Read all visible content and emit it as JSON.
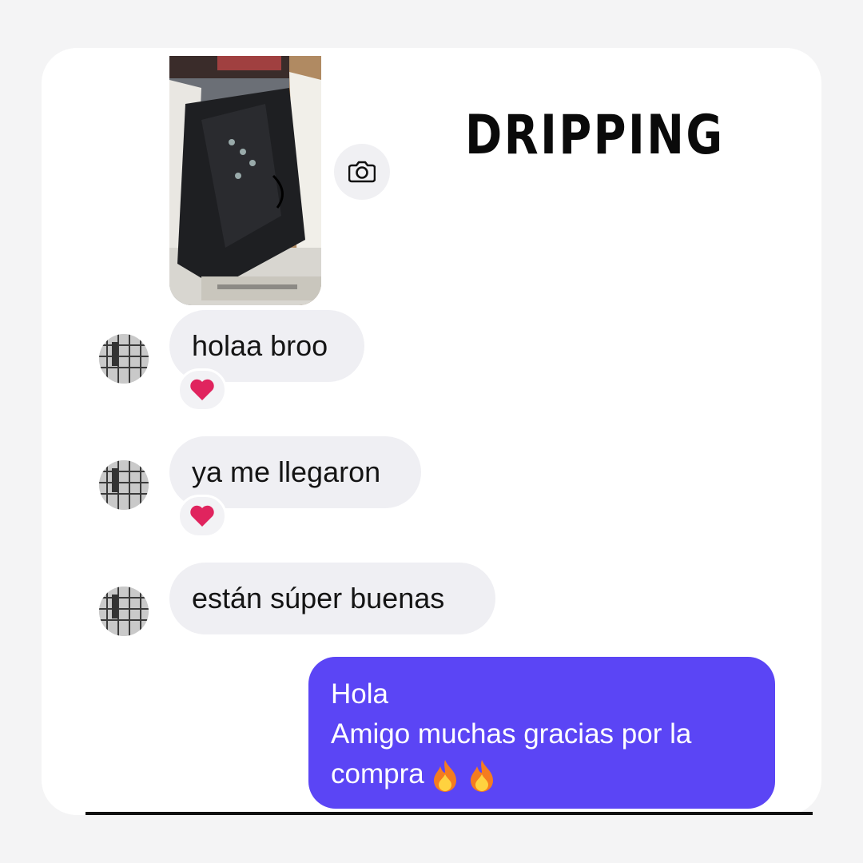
{
  "brand": {
    "title": "DRIPPING"
  },
  "image_message": {
    "alt": "shoe box photo"
  },
  "messages_received": [
    {
      "text": "holaa broo",
      "reaction": "heart"
    },
    {
      "text": "ya me llegaron",
      "reaction": "heart"
    },
    {
      "text": "están súper buenas",
      "reaction": null
    }
  ],
  "message_sent": {
    "line1": "Hola",
    "line2": "Amigo muchas gracias por la",
    "line3": "compra"
  },
  "colors": {
    "sent_bubble": "#5b45f5",
    "received_bubble": "#efeff3",
    "heart": "#e0245e"
  }
}
